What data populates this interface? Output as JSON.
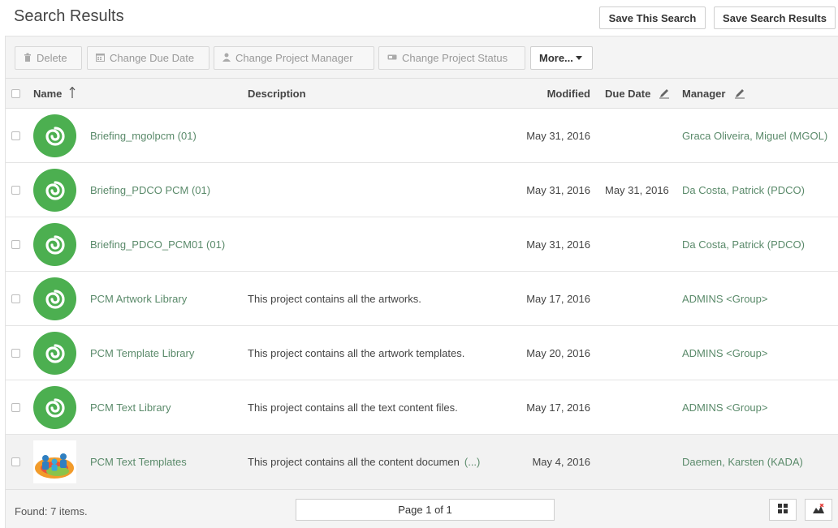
{
  "header": {
    "title": "Search Results",
    "save_search_label": "Save This Search",
    "save_results_label": "Save Search Results"
  },
  "toolbar": {
    "delete_label": "Delete",
    "change_due_date_label": "Change Due Date",
    "change_pm_label": "Change Project Manager",
    "change_status_label": "Change Project Status",
    "more_label": "More..."
  },
  "table": {
    "columns": {
      "name": "Name",
      "description": "Description",
      "modified": "Modified",
      "due_date": "Due Date",
      "manager": "Manager"
    },
    "rows": [
      {
        "name": "Briefing_mgolpcm (01)",
        "description": "",
        "more": "",
        "modified": "May 31, 2016",
        "due": "",
        "manager": "Graca Oliveira, Miguel (MGOL)"
      },
      {
        "name": "Briefing_PDCO PCM (01)",
        "description": "",
        "more": "",
        "modified": "May 31, 2016",
        "due": "May 31, 2016",
        "manager": "Da Costa, Patrick (PDCO)"
      },
      {
        "name": "Briefing_PDCO_PCM01 (01)",
        "description": "",
        "more": "",
        "modified": "May 31, 2016",
        "due": "",
        "manager": "Da Costa, Patrick (PDCO)"
      },
      {
        "name": "PCM Artwork Library",
        "description": "This project contains all the artworks.",
        "more": "",
        "modified": "May 17, 2016",
        "due": "",
        "manager": "ADMINS <Group>"
      },
      {
        "name": "PCM Template Library",
        "description": "This project contains all the artwork templates.",
        "more": "",
        "modified": "May 20, 2016",
        "due": "",
        "manager": "ADMINS <Group>"
      },
      {
        "name": "PCM Text Library",
        "description": "This project contains all the text content files.",
        "more": "",
        "modified": "May 17, 2016",
        "due": "",
        "manager": "ADMINS <Group>"
      },
      {
        "name": "PCM Text Templates",
        "description": "This project contains all the content documen",
        "more": "(...)",
        "modified": "May 4, 2016",
        "due": "",
        "manager": "Daemen, Karsten (KADA)"
      }
    ]
  },
  "footer": {
    "found_label": "Found: 7 items.",
    "page_label": "Page 1 of 1"
  },
  "colors": {
    "accent_green": "#4caf50",
    "link_green": "#5a8a6a"
  }
}
